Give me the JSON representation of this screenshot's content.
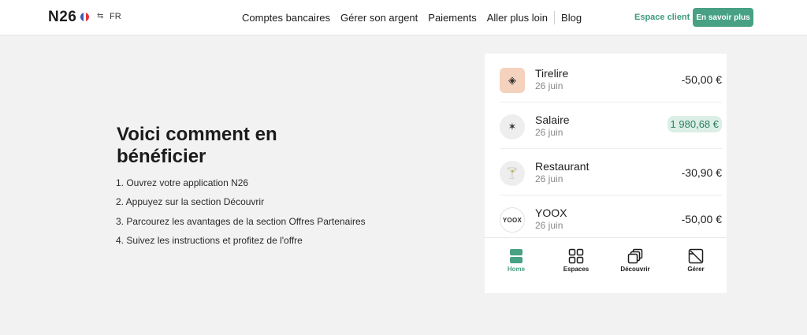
{
  "header": {
    "logo": "N26",
    "flag_colors": [
      "#3b5ab7",
      "#ffffff",
      "#e0363f"
    ],
    "lang_icon": "translate-icon",
    "lang": "FR",
    "nav": [
      "Comptes bancaires",
      "Gérer son argent",
      "Paiements",
      "Aller plus loin"
    ],
    "blog": "Blog",
    "client_link": "Espace client",
    "cta": "En savoir plus",
    "accent": "#48a184"
  },
  "main": {
    "title": "Voici comment en bénéficier",
    "steps": [
      "1. Ouvrez votre application N26",
      "2. Appuyez sur la section Découvrir",
      "3. Parcourez les avantages de la section Offres Partenaires",
      "4. Suivez les instructions et profitez de l'offre"
    ]
  },
  "phone": {
    "transactions": [
      {
        "icon": "piggy-bank-icon",
        "glyph": "◈",
        "name": "Tirelire",
        "date": "26 juin",
        "amount": "-50,00 €"
      },
      {
        "icon": "party-popper-icon",
        "glyph": "✶",
        "name": "Salaire",
        "date": "26 juin",
        "amount": "1 980,68 €"
      },
      {
        "icon": "cocktail-icon",
        "glyph": "🍸",
        "name": "Restaurant",
        "date": "26 juin",
        "amount": "-30,90 €"
      },
      {
        "icon": "yoox-logo",
        "glyph": "YOOX",
        "name": "YOOX",
        "date": "26 juin",
        "amount": "-50,00 €"
      }
    ],
    "tabs": [
      "Home",
      "Espaces",
      "Découvrir",
      "Gérer"
    ]
  }
}
